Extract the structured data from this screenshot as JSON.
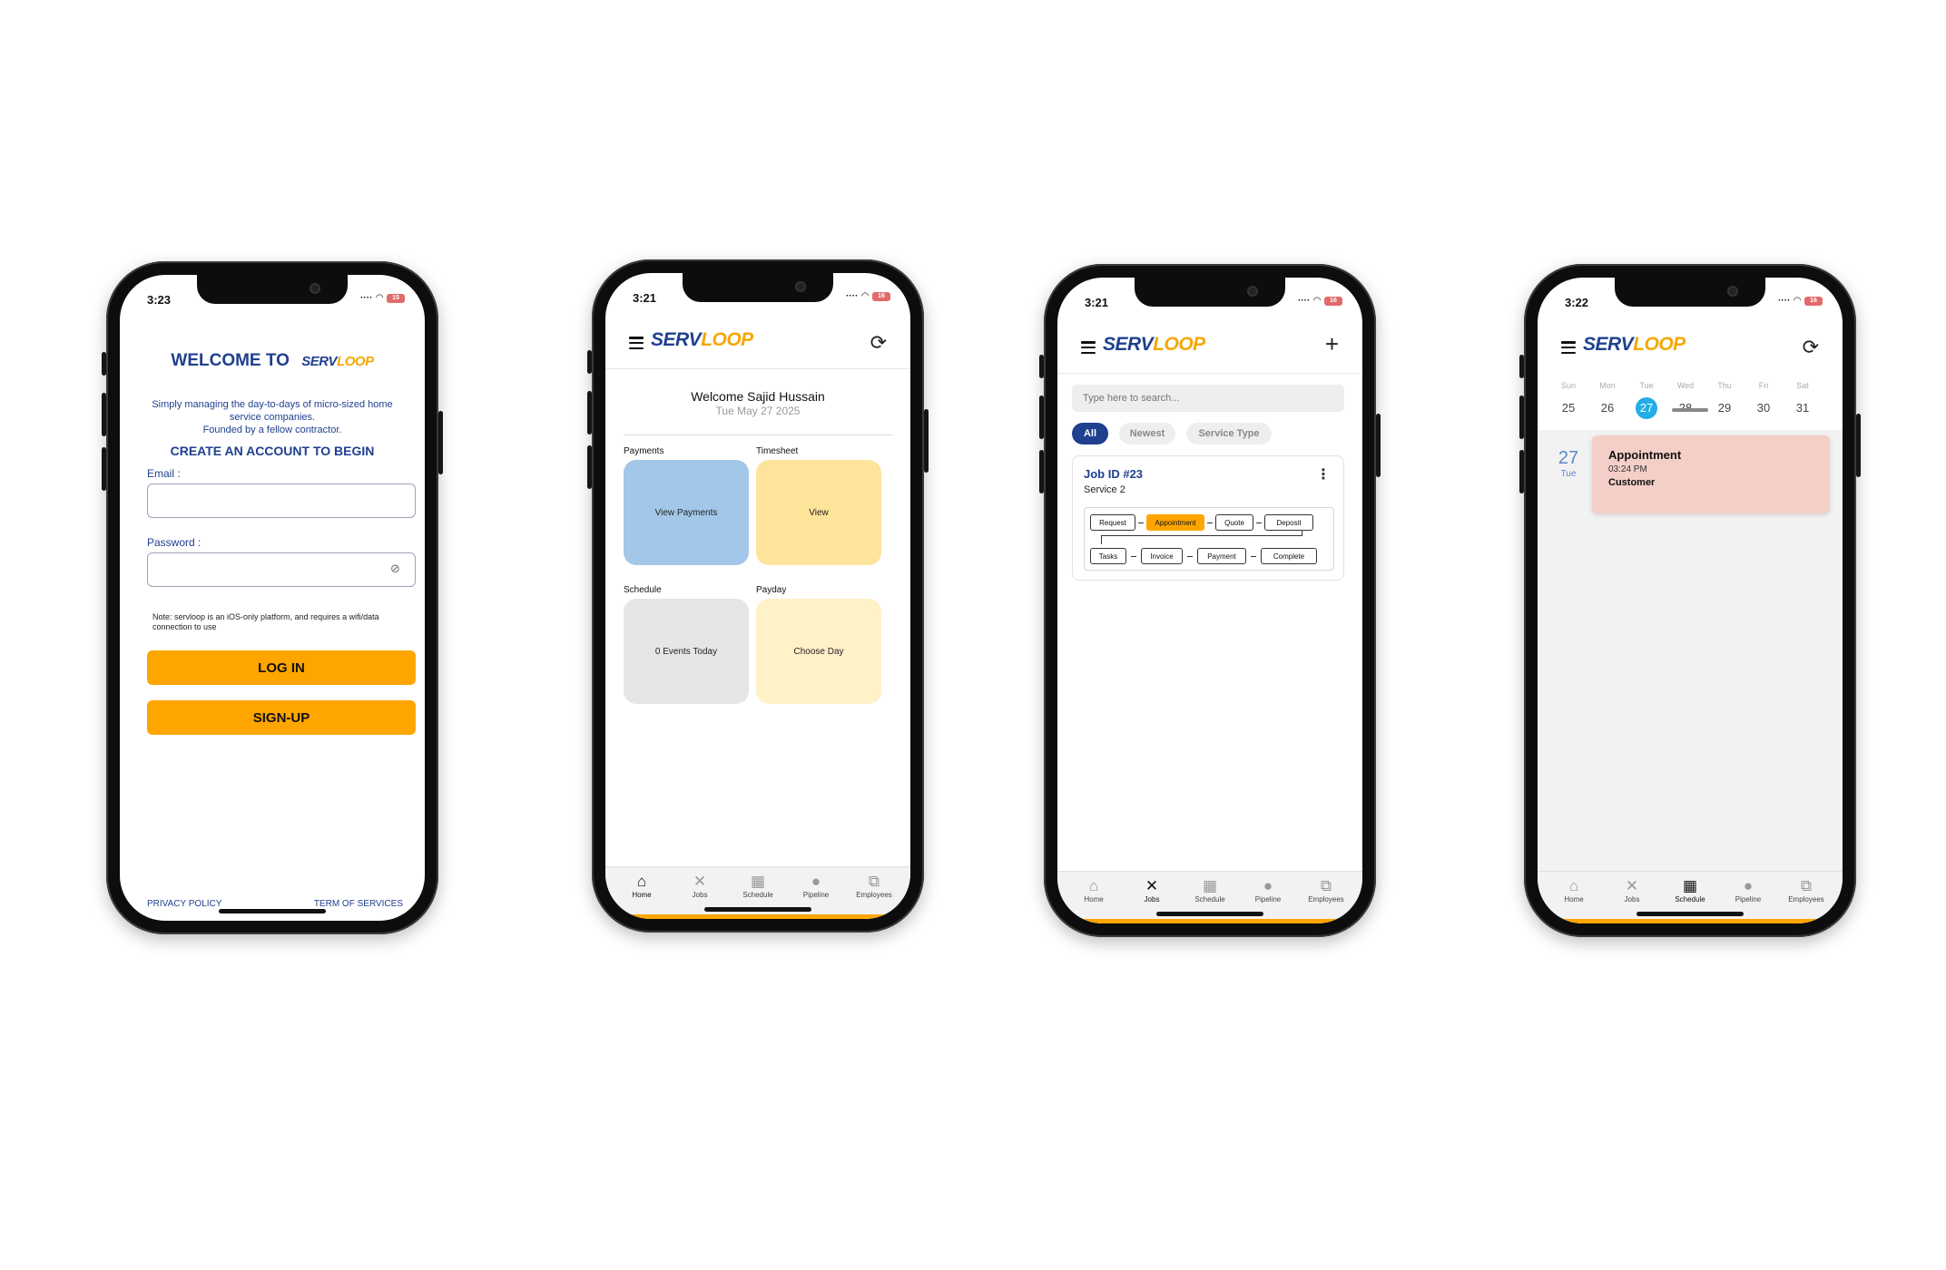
{
  "brand": {
    "serv": "SERV",
    "loop": "LOOP"
  },
  "login": {
    "time": "3:23",
    "welcome": "WELCOME TO",
    "tagline_1": "Simply managing the day-to-days of micro-sized home",
    "tagline_2": "service companies.",
    "tagline_3": "Founded by a fellow contractor.",
    "create": "CREATE AN ACCOUNT TO BEGIN",
    "email_label": "Email :",
    "email_value": "",
    "password_label": "Password :",
    "password_value": "",
    "note": "Note: servloop is an iOS-only platform, and requires a wifi/data connection to use",
    "login_btn": "LOG IN",
    "signup_btn": "SIGN-UP",
    "privacy": "PRIVACY POLICY",
    "terms": "TERM OF SERVICES"
  },
  "home": {
    "time": "3:21",
    "welcome": "Welcome Sajid Hussain",
    "date": "Tue May 27 2025",
    "payments_label": "Payments",
    "payments_tile": "View Payments",
    "timesheet_label": "Timesheet",
    "timesheet_tile": "View",
    "schedule_label": "Schedule",
    "schedule_tile": "0 Events Today",
    "payday_label": "Payday",
    "payday_tile": "Choose Day"
  },
  "jobs": {
    "time": "3:21",
    "search_placeholder": "Type here to search...",
    "filters": [
      "All",
      "Newest",
      "Service Type"
    ],
    "job_id": "Job ID #23",
    "service": "Service 2",
    "steps_row1": [
      "Request",
      "Appointment",
      "Quote",
      "Deposit"
    ],
    "steps_row2": [
      "Tasks",
      "Invoice",
      "Payment",
      "Complete"
    ],
    "active_step": "Appointment"
  },
  "schedule": {
    "time": "3:22",
    "days": [
      "Sun",
      "Mon",
      "Tue",
      "Wed",
      "Thu",
      "Fri",
      "Sat"
    ],
    "dates": [
      "25",
      "26",
      "27",
      "28",
      "29",
      "30",
      "31"
    ],
    "selected": "27",
    "event_day_num": "27",
    "event_day_name": "Tue",
    "event_title": "Appointment",
    "event_time": "03:24 PM",
    "event_customer": "Customer"
  },
  "tabs": [
    "Home",
    "Jobs",
    "Schedule",
    "Pipeline",
    "Employees"
  ],
  "colors": {
    "navy": "#1f3f8f",
    "orange": "#ffa500",
    "blue_tile": "#a3c7e8",
    "yellow_tile": "#fde49a",
    "gray_tile": "#e6e6e6",
    "cream_tile": "#fff1c8",
    "event": "#f3cfc8",
    "selected_date": "#22aee6"
  }
}
